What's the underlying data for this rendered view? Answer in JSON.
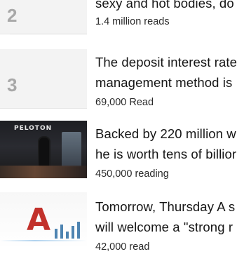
{
  "feed": {
    "items": [
      {
        "rank": "2",
        "title_lines": [
          "sexy and hot bodies, do",
          ""
        ],
        "meta": "1.4 million reads"
      },
      {
        "rank": "3",
        "title_lines": [
          "The deposit interest rate",
          "management method is"
        ],
        "meta": "69,000 Read"
      },
      {
        "thumb_logo": "PELOTON",
        "title_lines": [
          "Backed by 220 million w",
          "he is worth tens of billior"
        ],
        "meta": "450,000 reading"
      },
      {
        "thumb_letter": "A",
        "title_lines": [
          "Tomorrow, Thursday A s",
          "will welcome a \"strong r"
        ],
        "meta": "42,000 read"
      }
    ]
  }
}
